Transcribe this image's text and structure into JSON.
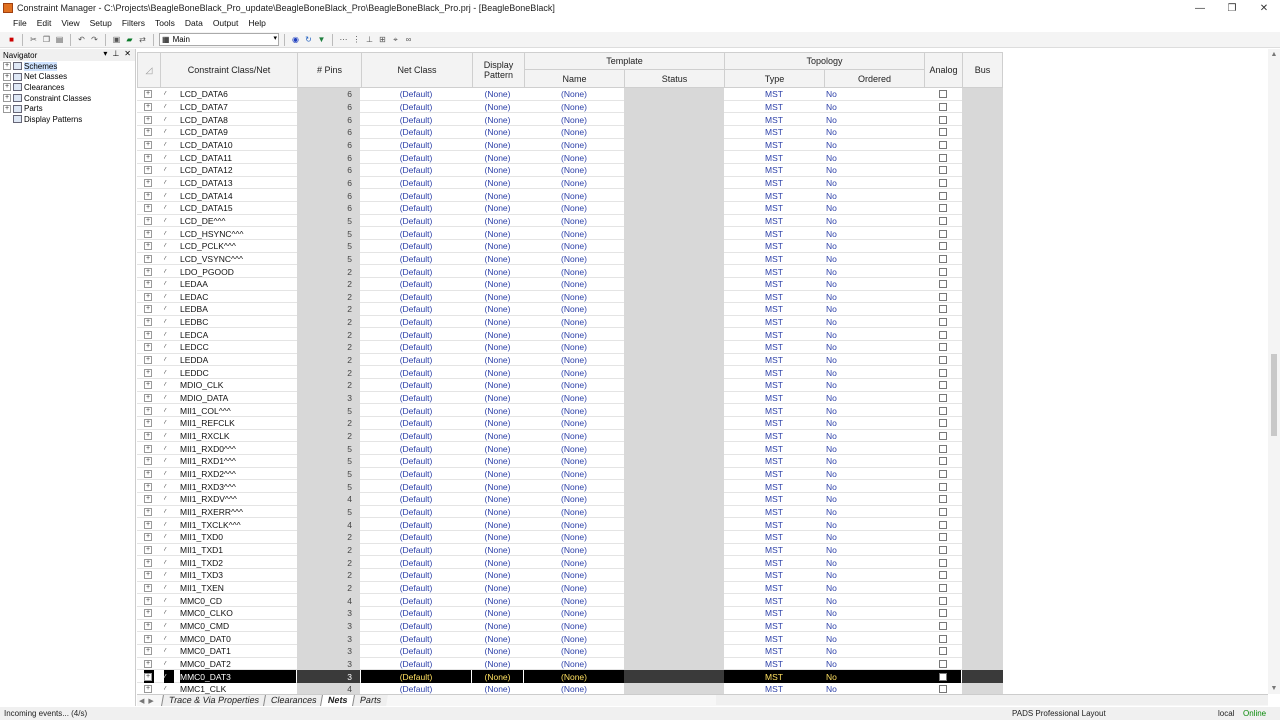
{
  "window": {
    "title": "Constraint Manager - C:\\Projects\\BeagleBoneBlack_Pro_update\\BeagleBoneBlack_Pro\\BeagleBoneBlack_Pro.prj - [BeagleBoneBlack]",
    "minimize": "—",
    "restore": "❐",
    "close": "✕"
  },
  "menu": [
    "File",
    "Edit",
    "View",
    "Setup",
    "Filters",
    "Tools",
    "Data",
    "Output",
    "Help"
  ],
  "toolbar": {
    "scheme": "Main"
  },
  "navigator": {
    "title": "Navigator",
    "items": [
      {
        "label": "Schemes",
        "expand": "+"
      },
      {
        "label": "Net Classes",
        "expand": "+"
      },
      {
        "label": "Clearances",
        "expand": "+"
      },
      {
        "label": "Constraint Classes",
        "expand": "+"
      },
      {
        "label": "Parts",
        "expand": "+"
      },
      {
        "label": "Display Patterns",
        "expand": ""
      }
    ]
  },
  "grid": {
    "headers": {
      "name": "Constraint Class/Net",
      "pins": "# Pins",
      "net_class": "Net Class",
      "display_pattern": "Display Pattern",
      "template": "Template",
      "template_name": "Name",
      "template_status": "Status",
      "topology": "Topology",
      "topology_type": "Type",
      "topology_ordered": "Ordered",
      "analog": "Analog",
      "bus": "Bus"
    },
    "rows": [
      {
        "name": "LCD_DATA6",
        "pins": "6",
        "net_class": "(Default)",
        "display": "(None)",
        "tname": "(None)",
        "type": "MST",
        "ordered": "No"
      },
      {
        "name": "LCD_DATA7",
        "pins": "6",
        "net_class": "(Default)",
        "display": "(None)",
        "tname": "(None)",
        "type": "MST",
        "ordered": "No"
      },
      {
        "name": "LCD_DATA8",
        "pins": "6",
        "net_class": "(Default)",
        "display": "(None)",
        "tname": "(None)",
        "type": "MST",
        "ordered": "No"
      },
      {
        "name": "LCD_DATA9",
        "pins": "6",
        "net_class": "(Default)",
        "display": "(None)",
        "tname": "(None)",
        "type": "MST",
        "ordered": "No"
      },
      {
        "name": "LCD_DATA10",
        "pins": "6",
        "net_class": "(Default)",
        "display": "(None)",
        "tname": "(None)",
        "type": "MST",
        "ordered": "No"
      },
      {
        "name": "LCD_DATA11",
        "pins": "6",
        "net_class": "(Default)",
        "display": "(None)",
        "tname": "(None)",
        "type": "MST",
        "ordered": "No"
      },
      {
        "name": "LCD_DATA12",
        "pins": "6",
        "net_class": "(Default)",
        "display": "(None)",
        "tname": "(None)",
        "type": "MST",
        "ordered": "No"
      },
      {
        "name": "LCD_DATA13",
        "pins": "6",
        "net_class": "(Default)",
        "display": "(None)",
        "tname": "(None)",
        "type": "MST",
        "ordered": "No"
      },
      {
        "name": "LCD_DATA14",
        "pins": "6",
        "net_class": "(Default)",
        "display": "(None)",
        "tname": "(None)",
        "type": "MST",
        "ordered": "No"
      },
      {
        "name": "LCD_DATA15",
        "pins": "6",
        "net_class": "(Default)",
        "display": "(None)",
        "tname": "(None)",
        "type": "MST",
        "ordered": "No"
      },
      {
        "name": "LCD_DE^^^",
        "pins": "5",
        "net_class": "(Default)",
        "display": "(None)",
        "tname": "(None)",
        "type": "MST",
        "ordered": "No"
      },
      {
        "name": "LCD_HSYNC^^^",
        "pins": "5",
        "net_class": "(Default)",
        "display": "(None)",
        "tname": "(None)",
        "type": "MST",
        "ordered": "No"
      },
      {
        "name": "LCD_PCLK^^^",
        "pins": "5",
        "net_class": "(Default)",
        "display": "(None)",
        "tname": "(None)",
        "type": "MST",
        "ordered": "No"
      },
      {
        "name": "LCD_VSYNC^^^",
        "pins": "5",
        "net_class": "(Default)",
        "display": "(None)",
        "tname": "(None)",
        "type": "MST",
        "ordered": "No"
      },
      {
        "name": "LDO_PGOOD",
        "pins": "2",
        "net_class": "(Default)",
        "display": "(None)",
        "tname": "(None)",
        "type": "MST",
        "ordered": "No"
      },
      {
        "name": "LEDAA",
        "pins": "2",
        "net_class": "(Default)",
        "display": "(None)",
        "tname": "(None)",
        "type": "MST",
        "ordered": "No"
      },
      {
        "name": "LEDAC",
        "pins": "2",
        "net_class": "(Default)",
        "display": "(None)",
        "tname": "(None)",
        "type": "MST",
        "ordered": "No"
      },
      {
        "name": "LEDBA",
        "pins": "2",
        "net_class": "(Default)",
        "display": "(None)",
        "tname": "(None)",
        "type": "MST",
        "ordered": "No"
      },
      {
        "name": "LEDBC",
        "pins": "2",
        "net_class": "(Default)",
        "display": "(None)",
        "tname": "(None)",
        "type": "MST",
        "ordered": "No"
      },
      {
        "name": "LEDCA",
        "pins": "2",
        "net_class": "(Default)",
        "display": "(None)",
        "tname": "(None)",
        "type": "MST",
        "ordered": "No"
      },
      {
        "name": "LEDCC",
        "pins": "2",
        "net_class": "(Default)",
        "display": "(None)",
        "tname": "(None)",
        "type": "MST",
        "ordered": "No"
      },
      {
        "name": "LEDDA",
        "pins": "2",
        "net_class": "(Default)",
        "display": "(None)",
        "tname": "(None)",
        "type": "MST",
        "ordered": "No"
      },
      {
        "name": "LEDDC",
        "pins": "2",
        "net_class": "(Default)",
        "display": "(None)",
        "tname": "(None)",
        "type": "MST",
        "ordered": "No"
      },
      {
        "name": "MDIO_CLK",
        "pins": "2",
        "net_class": "(Default)",
        "display": "(None)",
        "tname": "(None)",
        "type": "MST",
        "ordered": "No"
      },
      {
        "name": "MDIO_DATA",
        "pins": "3",
        "net_class": "(Default)",
        "display": "(None)",
        "tname": "(None)",
        "type": "MST",
        "ordered": "No"
      },
      {
        "name": "MII1_COL^^^",
        "pins": "5",
        "net_class": "(Default)",
        "display": "(None)",
        "tname": "(None)",
        "type": "MST",
        "ordered": "No"
      },
      {
        "name": "MII1_REFCLK",
        "pins": "2",
        "net_class": "(Default)",
        "display": "(None)",
        "tname": "(None)",
        "type": "MST",
        "ordered": "No"
      },
      {
        "name": "MII1_RXCLK",
        "pins": "2",
        "net_class": "(Default)",
        "display": "(None)",
        "tname": "(None)",
        "type": "MST",
        "ordered": "No"
      },
      {
        "name": "MII1_RXD0^^^",
        "pins": "5",
        "net_class": "(Default)",
        "display": "(None)",
        "tname": "(None)",
        "type": "MST",
        "ordered": "No"
      },
      {
        "name": "MII1_RXD1^^^",
        "pins": "5",
        "net_class": "(Default)",
        "display": "(None)",
        "tname": "(None)",
        "type": "MST",
        "ordered": "No"
      },
      {
        "name": "MII1_RXD2^^^",
        "pins": "5",
        "net_class": "(Default)",
        "display": "(None)",
        "tname": "(None)",
        "type": "MST",
        "ordered": "No"
      },
      {
        "name": "MII1_RXD3^^^",
        "pins": "5",
        "net_class": "(Default)",
        "display": "(None)",
        "tname": "(None)",
        "type": "MST",
        "ordered": "No"
      },
      {
        "name": "MII1_RXDV^^^",
        "pins": "4",
        "net_class": "(Default)",
        "display": "(None)",
        "tname": "(None)",
        "type": "MST",
        "ordered": "No"
      },
      {
        "name": "MII1_RXERR^^^",
        "pins": "5",
        "net_class": "(Default)",
        "display": "(None)",
        "tname": "(None)",
        "type": "MST",
        "ordered": "No"
      },
      {
        "name": "MII1_TXCLK^^^",
        "pins": "4",
        "net_class": "(Default)",
        "display": "(None)",
        "tname": "(None)",
        "type": "MST",
        "ordered": "No"
      },
      {
        "name": "MII1_TXD0",
        "pins": "2",
        "net_class": "(Default)",
        "display": "(None)",
        "tname": "(None)",
        "type": "MST",
        "ordered": "No"
      },
      {
        "name": "MII1_TXD1",
        "pins": "2",
        "net_class": "(Default)",
        "display": "(None)",
        "tname": "(None)",
        "type": "MST",
        "ordered": "No"
      },
      {
        "name": "MII1_TXD2",
        "pins": "2",
        "net_class": "(Default)",
        "display": "(None)",
        "tname": "(None)",
        "type": "MST",
        "ordered": "No"
      },
      {
        "name": "MII1_TXD3",
        "pins": "2",
        "net_class": "(Default)",
        "display": "(None)",
        "tname": "(None)",
        "type": "MST",
        "ordered": "No"
      },
      {
        "name": "MII1_TXEN",
        "pins": "2",
        "net_class": "(Default)",
        "display": "(None)",
        "tname": "(None)",
        "type": "MST",
        "ordered": "No"
      },
      {
        "name": "MMC0_CD",
        "pins": "4",
        "net_class": "(Default)",
        "display": "(None)",
        "tname": "(None)",
        "type": "MST",
        "ordered": "No"
      },
      {
        "name": "MMC0_CLKO",
        "pins": "3",
        "net_class": "(Default)",
        "display": "(None)",
        "tname": "(None)",
        "type": "MST",
        "ordered": "No"
      },
      {
        "name": "MMC0_CMD",
        "pins": "3",
        "net_class": "(Default)",
        "display": "(None)",
        "tname": "(None)",
        "type": "MST",
        "ordered": "No"
      },
      {
        "name": "MMC0_DAT0",
        "pins": "3",
        "net_class": "(Default)",
        "display": "(None)",
        "tname": "(None)",
        "type": "MST",
        "ordered": "No"
      },
      {
        "name": "MMC0_DAT1",
        "pins": "3",
        "net_class": "(Default)",
        "display": "(None)",
        "tname": "(None)",
        "type": "MST",
        "ordered": "No"
      },
      {
        "name": "MMC0_DAT2",
        "pins": "3",
        "net_class": "(Default)",
        "display": "(None)",
        "tname": "(None)",
        "type": "MST",
        "ordered": "No"
      },
      {
        "name": "MMC0_DAT3",
        "pins": "3",
        "net_class": "(Default)",
        "display": "(None)",
        "tname": "(None)",
        "type": "MST",
        "ordered": "No",
        "selected": true
      },
      {
        "name": "MMC1_CLK",
        "pins": "4",
        "net_class": "(Default)",
        "display": "(None)",
        "tname": "(None)",
        "type": "MST",
        "ordered": "No"
      }
    ]
  },
  "tabs": [
    {
      "label": "Trace & Via Properties",
      "active": false
    },
    {
      "label": "Clearances",
      "active": false
    },
    {
      "label": "Nets",
      "active": true
    },
    {
      "label": "Parts",
      "active": false
    }
  ],
  "status": {
    "left": "Incoming events... (4/s)",
    "product": "PADS Professional Layout",
    "local": "local",
    "online": "Online"
  }
}
